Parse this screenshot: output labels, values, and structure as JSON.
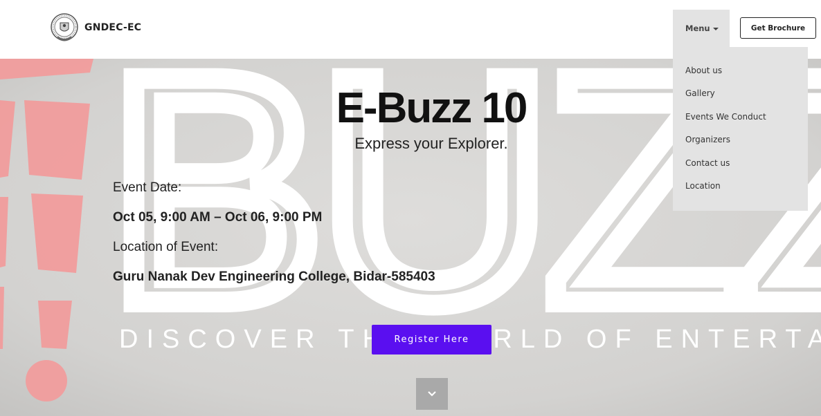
{
  "header": {
    "brand_name": "GNDEC-EC",
    "logo_icon": "college-emblem-logo",
    "menu_label": "Menu",
    "brochure_label": "Get Brochure"
  },
  "menu": {
    "items": [
      {
        "label": "About us"
      },
      {
        "label": "Gallery"
      },
      {
        "label": "Events We Conduct"
      },
      {
        "label": "Organizers"
      },
      {
        "label": "Contact us"
      },
      {
        "label": "Location"
      }
    ]
  },
  "hero": {
    "title": "E-Buzz 10",
    "subtitle": "Express your Explorer.",
    "date_label": "Event Date:",
    "date_value": "Oct 05, 9:00 AM – Oct 06, 9:00 PM",
    "location_label": "Location of Event:",
    "location_value": "Guru Nanak Dev Engineering College, Bidar-585403",
    "register_label": "Register Here",
    "background_text": "BUZZ",
    "background_tagline": "DISCOVER THE WORLD OF ENTERTAINMENT",
    "scroll_icon": "chevron-down-icon"
  },
  "colors": {
    "accent": "#5a0ff0",
    "hero_bg": "#d6d5d3",
    "menu_bg": "#e3e3e3",
    "exclaim": "#f39a9a"
  }
}
